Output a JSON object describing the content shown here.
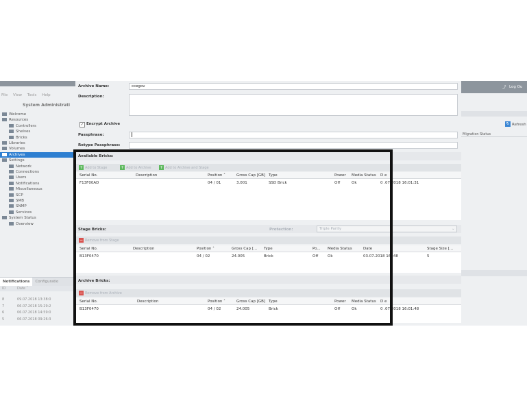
{
  "menu": [
    "File",
    "View",
    "Tools",
    "Help"
  ],
  "app_title": "System Administrati",
  "logout": "Log Ou",
  "refresh": "Refresh",
  "migration_status": "Migration Status",
  "tree": [
    {
      "label": "Welcome",
      "indent": 0,
      "icon": "welcome-icon",
      "selected": false
    },
    {
      "label": "Resources",
      "indent": 0,
      "icon": "resources-icon",
      "selected": false
    },
    {
      "label": "Controllers",
      "indent": 1,
      "icon": "controller-icon",
      "selected": false
    },
    {
      "label": "Shelves",
      "indent": 1,
      "icon": "shelf-icon",
      "selected": false
    },
    {
      "label": "Bricks",
      "indent": 1,
      "icon": "brick-icon",
      "selected": false
    },
    {
      "label": "Libraries",
      "indent": 0,
      "icon": "library-icon",
      "selected": false
    },
    {
      "label": "Volumes",
      "indent": 0,
      "icon": "volume-icon",
      "selected": false
    },
    {
      "label": "Archives",
      "indent": 0,
      "icon": "archive-icon",
      "selected": true
    },
    {
      "label": "Settings",
      "indent": 0,
      "icon": "settings-icon",
      "selected": false
    },
    {
      "label": "Network",
      "indent": 1,
      "icon": "network-icon",
      "selected": false
    },
    {
      "label": "Connections",
      "indent": 1,
      "icon": "connections-icon",
      "selected": false
    },
    {
      "label": "Users",
      "indent": 1,
      "icon": "users-icon",
      "selected": false
    },
    {
      "label": "Notifications",
      "indent": 1,
      "icon": "bell-icon",
      "selected": false
    },
    {
      "label": "Miscellaneous",
      "indent": 1,
      "icon": "star-icon",
      "selected": false
    },
    {
      "label": "SCP",
      "indent": 1,
      "icon": "scp-icon",
      "selected": false
    },
    {
      "label": "SMB",
      "indent": 1,
      "icon": "smb-icon",
      "selected": false
    },
    {
      "label": "SNMP",
      "indent": 1,
      "icon": "snmp-icon",
      "selected": false
    },
    {
      "label": "Services",
      "indent": 1,
      "icon": "services-icon",
      "selected": false
    },
    {
      "label": "System Status",
      "indent": 0,
      "icon": "info-icon",
      "selected": false
    },
    {
      "label": "Overview",
      "indent": 1,
      "icon": "eye-icon",
      "selected": false
    }
  ],
  "bottom_tabs": [
    "Notifications",
    "Configuratio"
  ],
  "notif_head": {
    "id": "ID",
    "date": "Date ˅"
  },
  "notifications": [
    {
      "id": "8",
      "date": "09.07.2018 13:38:0"
    },
    {
      "id": "7",
      "date": "06.07.2018 15:29:2"
    },
    {
      "id": "6",
      "date": "06.07.2018 14:59:0"
    },
    {
      "id": "5",
      "date": "06.07.2018 09:26:3"
    }
  ],
  "form": {
    "archive_name_label": "Archive Name:",
    "archive_name_value": "ccegov",
    "description_label": "Description:",
    "encrypt_label": "Encrypt Archive",
    "encrypt_checked": true,
    "passphrase_label": "Passphrase:",
    "retype_label": "Retype Passphrase:"
  },
  "available": {
    "title": "Available Bricks:",
    "buttons": [
      "Add to Stage",
      "Add to Archive",
      "Add to Archive and Stage"
    ],
    "columns": [
      "Serial No.",
      "Description",
      "Position ˄",
      "Gross Cap [GB]",
      "Type",
      "Power",
      "Media Status",
      "D e"
    ],
    "rows": [
      [
        "F13F00AD",
        "",
        "04 / 01",
        "3.001",
        "SSD Brick",
        "Off",
        "Ok",
        "0 .07.2018 16:01:31"
      ]
    ]
  },
  "stage": {
    "title": "Stage Bricks:",
    "protection_label": "Protection:",
    "protection_value": "Triple Parity",
    "buttons": [
      "Remove from Stage"
    ],
    "columns": [
      "Serial No.",
      "Description",
      "Position ˄",
      "Gross Cap [...",
      "Type",
      "Po...",
      "Media Status",
      "Date",
      "Stage Size [..."
    ],
    "rows": [
      [
        "B13F0470",
        "",
        "04 / 02",
        "24.005",
        "Brick",
        "Off",
        "Ok",
        "03.07.2018 16 :48",
        "5"
      ]
    ]
  },
  "archive": {
    "title": "Archive Bricks:",
    "buttons": [
      "Remove from Archive"
    ],
    "columns": [
      "Serial No.",
      "Description",
      "Position ˄",
      "Gross Cap [GB]",
      "Type",
      "Power",
      "Media Status",
      "D e"
    ],
    "rows": [
      [
        "B13F0470",
        "",
        "04 / 02",
        "24.005",
        "Brick",
        "Off",
        "Ok",
        "0 .07.2018 16:01:48"
      ]
    ]
  }
}
